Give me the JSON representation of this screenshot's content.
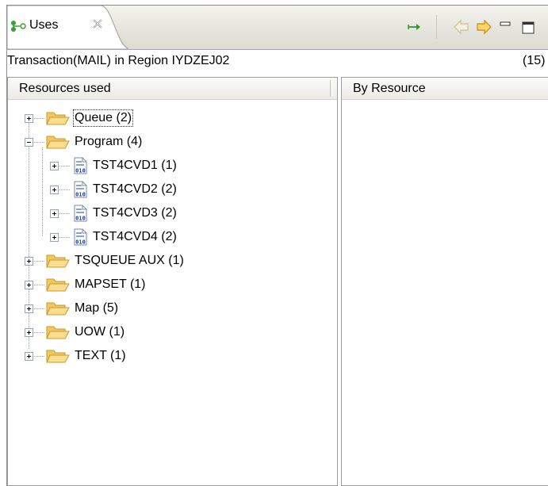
{
  "view_tab": {
    "label": "Uses",
    "icon": "uses-view-icon",
    "close_icon": "close-icon"
  },
  "toolbar": {
    "icons": [
      "show-links-arrow-icon",
      "back-arrow-icon",
      "forward-arrow-icon",
      "minimize-icon",
      "maximize-icon"
    ]
  },
  "header": {
    "title": "Transaction(MAIL) in Region IYDZEJ02",
    "count": "(15)"
  },
  "left_pane": {
    "column_header": "Resources used",
    "tree": [
      {
        "label": "Queue  (2)",
        "state": "collapsed",
        "selected": true
      },
      {
        "label": "Program  (4)",
        "state": "expanded",
        "children": [
          {
            "label": "TST4CVD1 (1)"
          },
          {
            "label": "TST4CVD2 (2)"
          },
          {
            "label": "TST4CVD3 (2)"
          },
          {
            "label": "TST4CVD4 (2)"
          }
        ]
      },
      {
        "label": "TSQUEUE AUX  (1)",
        "state": "collapsed"
      },
      {
        "label": "MAPSET  (1)",
        "state": "collapsed"
      },
      {
        "label": "Map  (5)",
        "state": "collapsed"
      },
      {
        "label": "UOW  (1)",
        "state": "collapsed"
      },
      {
        "label": "TEXT  (1)",
        "state": "collapsed"
      }
    ]
  },
  "right_pane": {
    "column_header": "By Resource"
  },
  "colors": {
    "tabbar_bg": "#e6e5dd",
    "folder_fill": "#f7d98a",
    "folder_stroke": "#c79a2c",
    "arrow_green": "#2a9d2a",
    "forward_arrow": "#f0b323",
    "back_arrow_disabled": "#cdbf98"
  }
}
